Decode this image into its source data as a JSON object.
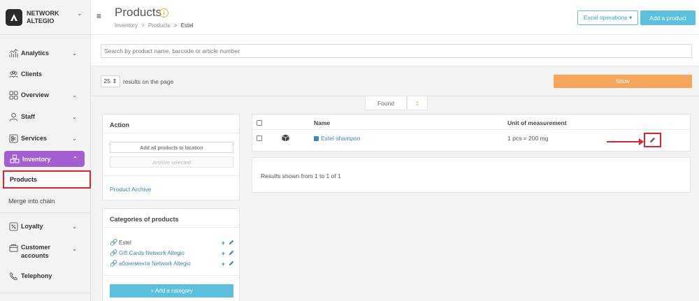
{
  "brand": {
    "line1": "NETWORK",
    "line2": "ALTEGIO"
  },
  "sidebar": {
    "items": [
      {
        "label": "Analytics",
        "icon": "analytics-icon",
        "has_chevron": true
      },
      {
        "label": "Clients",
        "icon": "clients-icon",
        "has_chevron": false
      },
      {
        "label": "Overview",
        "icon": "overview-icon",
        "has_chevron": true
      },
      {
        "label": "Staff",
        "icon": "staff-icon",
        "has_chevron": true
      },
      {
        "label": "Services",
        "icon": "services-icon",
        "has_chevron": true
      },
      {
        "label": "Inventory",
        "icon": "inventory-icon",
        "has_chevron": true
      },
      {
        "label": "Loyalty",
        "icon": "loyalty-icon",
        "has_chevron": true
      },
      {
        "label": "Customer accounts",
        "icon": "wallet-icon",
        "has_chevron": true
      },
      {
        "label": "Telephony",
        "icon": "phone-icon",
        "has_chevron": false
      }
    ],
    "sub_items": [
      {
        "label": "Products"
      },
      {
        "label": "Merge into chain"
      }
    ],
    "chevron_down": "⌄",
    "chevron_up": "⌃"
  },
  "header": {
    "title": "Products",
    "info_glyph": "i",
    "breadcrumb": [
      "Inventory",
      ">",
      "Products",
      ">",
      "Estel"
    ],
    "excel_button": "Excel operations ▾",
    "add_button": "Add a product",
    "menu_glyph": "≡"
  },
  "search": {
    "placeholder": "Search by product name, barcode or article number"
  },
  "results": {
    "per_page": "25 ⇕",
    "per_page_label": "results on the page",
    "show_button": "Show"
  },
  "found": {
    "label": "Found",
    "count": "1"
  },
  "action_panel": {
    "title": "Action",
    "add_all_button": "Add all products to location",
    "archive_button": "Archive selected",
    "archive_link": "Product Archive"
  },
  "categories_panel": {
    "title": "Categories of products",
    "categories": [
      {
        "name": "Estel",
        "link": false
      },
      {
        "name": "Gift Cards Network Altegio",
        "link": true
      },
      {
        "name": "абонементи Network Altegio",
        "link": true
      }
    ],
    "add_glyph": "+",
    "add_category_button": "+ Add a category"
  },
  "table": {
    "headers": {
      "name": "Name",
      "unit": "Unit of measurement"
    },
    "rows": [
      {
        "name": "Estel shampoo",
        "unit": "1 pcs = 200 mg"
      }
    ],
    "summary": "Results shown from 1 to 1 of 1"
  },
  "colors": {
    "accent_purple": "#a35ed4",
    "info_blue": "#5bc0de",
    "orange": "#f8a65a",
    "highlight_red": "#e0232e",
    "link_blue": "#3c87b7"
  }
}
